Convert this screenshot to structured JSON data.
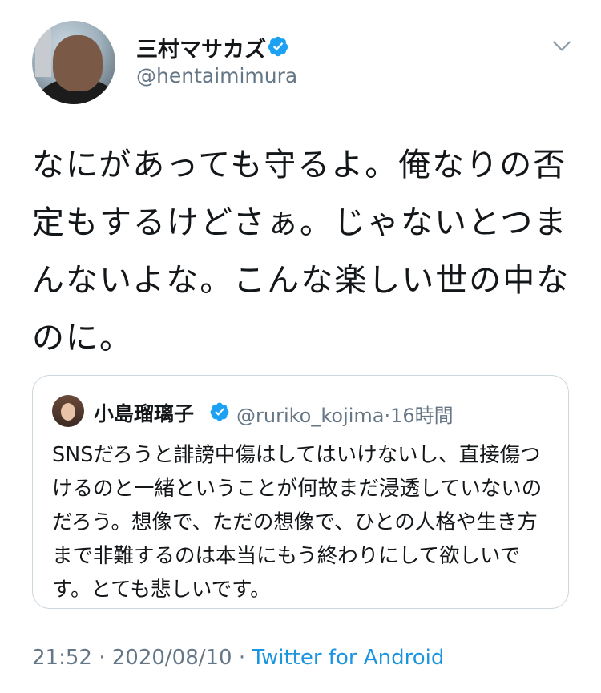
{
  "author": {
    "name": "三村マサカズ",
    "handle": "@hentaimimura",
    "verified": true
  },
  "tweet": {
    "text": "なにがあっても守るよ。俺なりの否定もするけどさぁ。じゃないとつまんないよな。こんな楽しい世の中なのに。"
  },
  "quoted": {
    "name": "小島瑠璃子",
    "handle": "@ruriko_kojima",
    "time": "·16時間",
    "verified": true,
    "text": "SNSだろうと誹謗中傷はしてはいけないし、直接傷つけるのと一緒ということが何故まだ浸透していないのだろう。想像で、ただの想像で、ひとの人格や生き方まで非難するのは本当にもう終わりにして欲しいです。とても悲しいです。"
  },
  "meta": {
    "time": "21:52",
    "separator1": " · ",
    "date": "2020/08/10",
    "separator2": " · ",
    "source": "Twitter for Android"
  },
  "colors": {
    "accent": "#1b95e0",
    "verified_badge": "#1da1f2",
    "secondary_text": "#657786",
    "border": "#ccd6dd"
  },
  "icons": {
    "verified": "verified-badge-icon",
    "caret": "chevron-down-icon"
  }
}
